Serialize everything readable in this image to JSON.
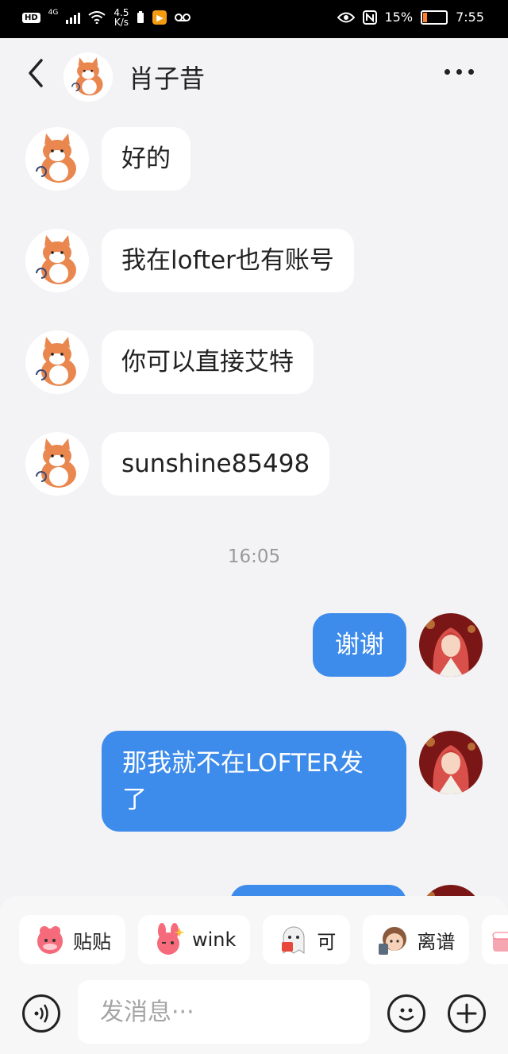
{
  "status_bar": {
    "hd": "HD",
    "network": "4G",
    "net_speed_value": "4.5",
    "net_speed_unit": "K/s",
    "battery": "15%",
    "time": "7:55",
    "battery_level_fraction": 0.15
  },
  "header": {
    "contact_name": "肖子昔"
  },
  "messages": [
    {
      "from": "them",
      "text": "好的"
    },
    {
      "from": "them",
      "text": "我在lofter也有账号"
    },
    {
      "from": "them",
      "text": "你可以直接艾特"
    },
    {
      "from": "them",
      "text": "sunshine85498"
    },
    {
      "from": "me",
      "text": "谢谢"
    },
    {
      "from": "me",
      "text_line1": "那我就不在LOFTER发",
      "text_line2": "了"
    }
  ],
  "timestamp": "16:05",
  "stickers": [
    {
      "label": "贴贴"
    },
    {
      "label": "wink"
    },
    {
      "label": "可"
    },
    {
      "label": "离谱"
    }
  ],
  "input": {
    "placeholder": "发消息···"
  },
  "colors": {
    "accent": "#3d8bea",
    "background": "#f3f3f5",
    "battery": "#ff7f2a"
  }
}
